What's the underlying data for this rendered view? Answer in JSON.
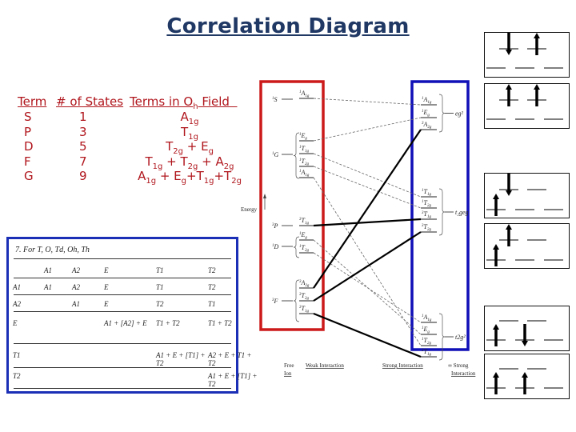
{
  "title": "Correlation Diagram",
  "term_table": {
    "headers": [
      "Term",
      "# of States",
      "Terms in Oh Field"
    ],
    "header_field_base": "Terms in O",
    "header_field_sub": "h",
    "header_field_rest": " Field",
    "rows": [
      {
        "term": "S",
        "states": "1",
        "field_html": "A<sub>1g</sub>"
      },
      {
        "term": "P",
        "states": "3",
        "field_html": "T<sub>1g</sub>"
      },
      {
        "term": "D",
        "states": "5",
        "field_html": "T<sub>2g</sub> + E<sub>g</sub>"
      },
      {
        "term": "F",
        "states": "7",
        "field_html": "T<sub>1g</sub> + T<sub>2g</sub> + A<sub>2g</sub>"
      },
      {
        "term": "G",
        "states": "9",
        "field_html": "A<sub>1g</sub> + E<sub>g</sub>+T<sub>1g</sub>+T<sub>2g</sub>"
      }
    ],
    "text_color": "#b0161d"
  },
  "product_table": {
    "caption": "7.  For T, O, Td, Oh, Th",
    "col_headers": [
      "A1",
      "A2",
      "E",
      "T1",
      "T2"
    ],
    "rows": [
      {
        "label": "A1",
        "cells": [
          "A1",
          "A2",
          "E",
          "T1",
          "T2"
        ]
      },
      {
        "label": "A2",
        "cells": [
          "",
          "A1",
          "E",
          "T2",
          "T1"
        ]
      },
      {
        "label": "E",
        "cells": [
          "",
          "",
          "A1 + [A2] + E",
          "T1 + T2",
          "T1 + T2"
        ]
      },
      {
        "label": "T1",
        "cells": [
          "",
          "",
          "",
          "A1 + E + [T1] + T2",
          "A2 + E + T1 + T2"
        ]
      },
      {
        "label": "T2",
        "cells": [
          "",
          "",
          "",
          "",
          "A1 + E + [T1] + T2"
        ]
      }
    ],
    "border_color": "#1a2fb5"
  },
  "correlation": {
    "energy_label": "Energy",
    "free_ion_terms": [
      "1S",
      "1G",
      "3P",
      "1D",
      "3F"
    ],
    "weak_field_levels": [
      "1A1g",
      "1Eg",
      "1T1g",
      "1T2g",
      "1A1g",
      "3T1g",
      "1Eg",
      "1T2g",
      "3A2g",
      "3T2g",
      "3T1g"
    ],
    "strong_field_groups": [
      {
        "config": "eg2",
        "levels": [
          "1A1g",
          "1Eg",
          "3A2g"
        ]
      },
      {
        "config": "t2geg",
        "levels": [
          "1T1g",
          "1T2g",
          "3T1g",
          "3T2g"
        ]
      },
      {
        "config": "t2g2",
        "levels": [
          "1A1g",
          "1Eg",
          "1T2g",
          "3T1g"
        ]
      }
    ],
    "bottom_labels": {
      "free_ion": "Free Ion",
      "free_ion_line1": "Free",
      "free_ion_line2": "Ion",
      "weak": "Weak Interaction",
      "strong": "Strong Interaction",
      "infinite_line1": "∞ Strong",
      "infinite_line2": "Interaction"
    },
    "weak_box_color": "#cc1a1a",
    "strong_box_color": "#1010b8"
  },
  "electron_configs": [
    {
      "name": "eg2-paired",
      "upper": [
        "down",
        "up",
        null
      ],
      "lower_count": 3,
      "upper_count": 2,
      "note": "eg pair on top, three empty t2g"
    },
    {
      "name": "eg2-triplet",
      "upper": [
        "up",
        "up"
      ]
    },
    {
      "name": "t2geg-singlet",
      "upper": [
        "down",
        null
      ],
      "lower": [
        "up",
        null,
        null
      ]
    },
    {
      "name": "t2geg-triplet",
      "upper": [
        "up",
        null
      ],
      "lower": [
        "up",
        null,
        null
      ]
    },
    {
      "name": "t2g2-singlet",
      "upper": [
        null,
        null
      ],
      "lower": [
        "up",
        "down",
        null
      ]
    },
    {
      "name": "t2g2-triplet",
      "upper": [
        null,
        null
      ],
      "lower": [
        "up",
        "up",
        null
      ]
    }
  ]
}
